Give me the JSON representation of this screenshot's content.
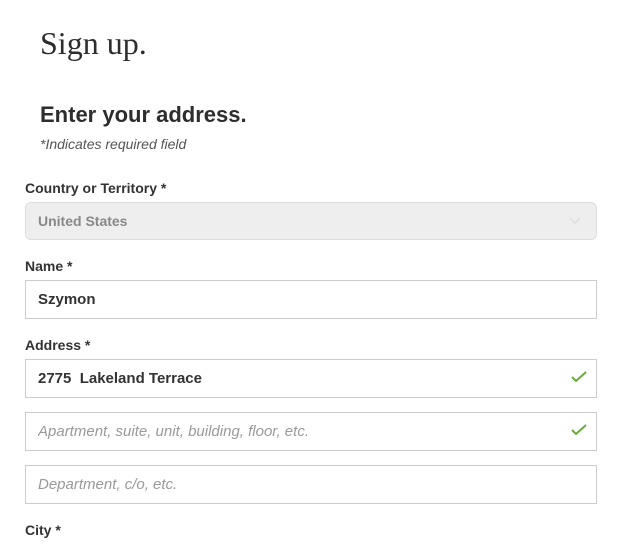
{
  "page": {
    "title": "Sign up.",
    "section_title": "Enter your address.",
    "required_note": "*Indicates required field"
  },
  "fields": {
    "country": {
      "label": "Country or Territory *",
      "value": "United States"
    },
    "name": {
      "label": "Name *",
      "value": "Szymon"
    },
    "address": {
      "label": "Address *",
      "line1_value": "2775  Lakeland Terrace",
      "line2_placeholder": "Apartment, suite, unit, building, floor, etc.",
      "line3_placeholder": "Department, c/o, etc."
    },
    "city": {
      "label": "City *"
    }
  }
}
